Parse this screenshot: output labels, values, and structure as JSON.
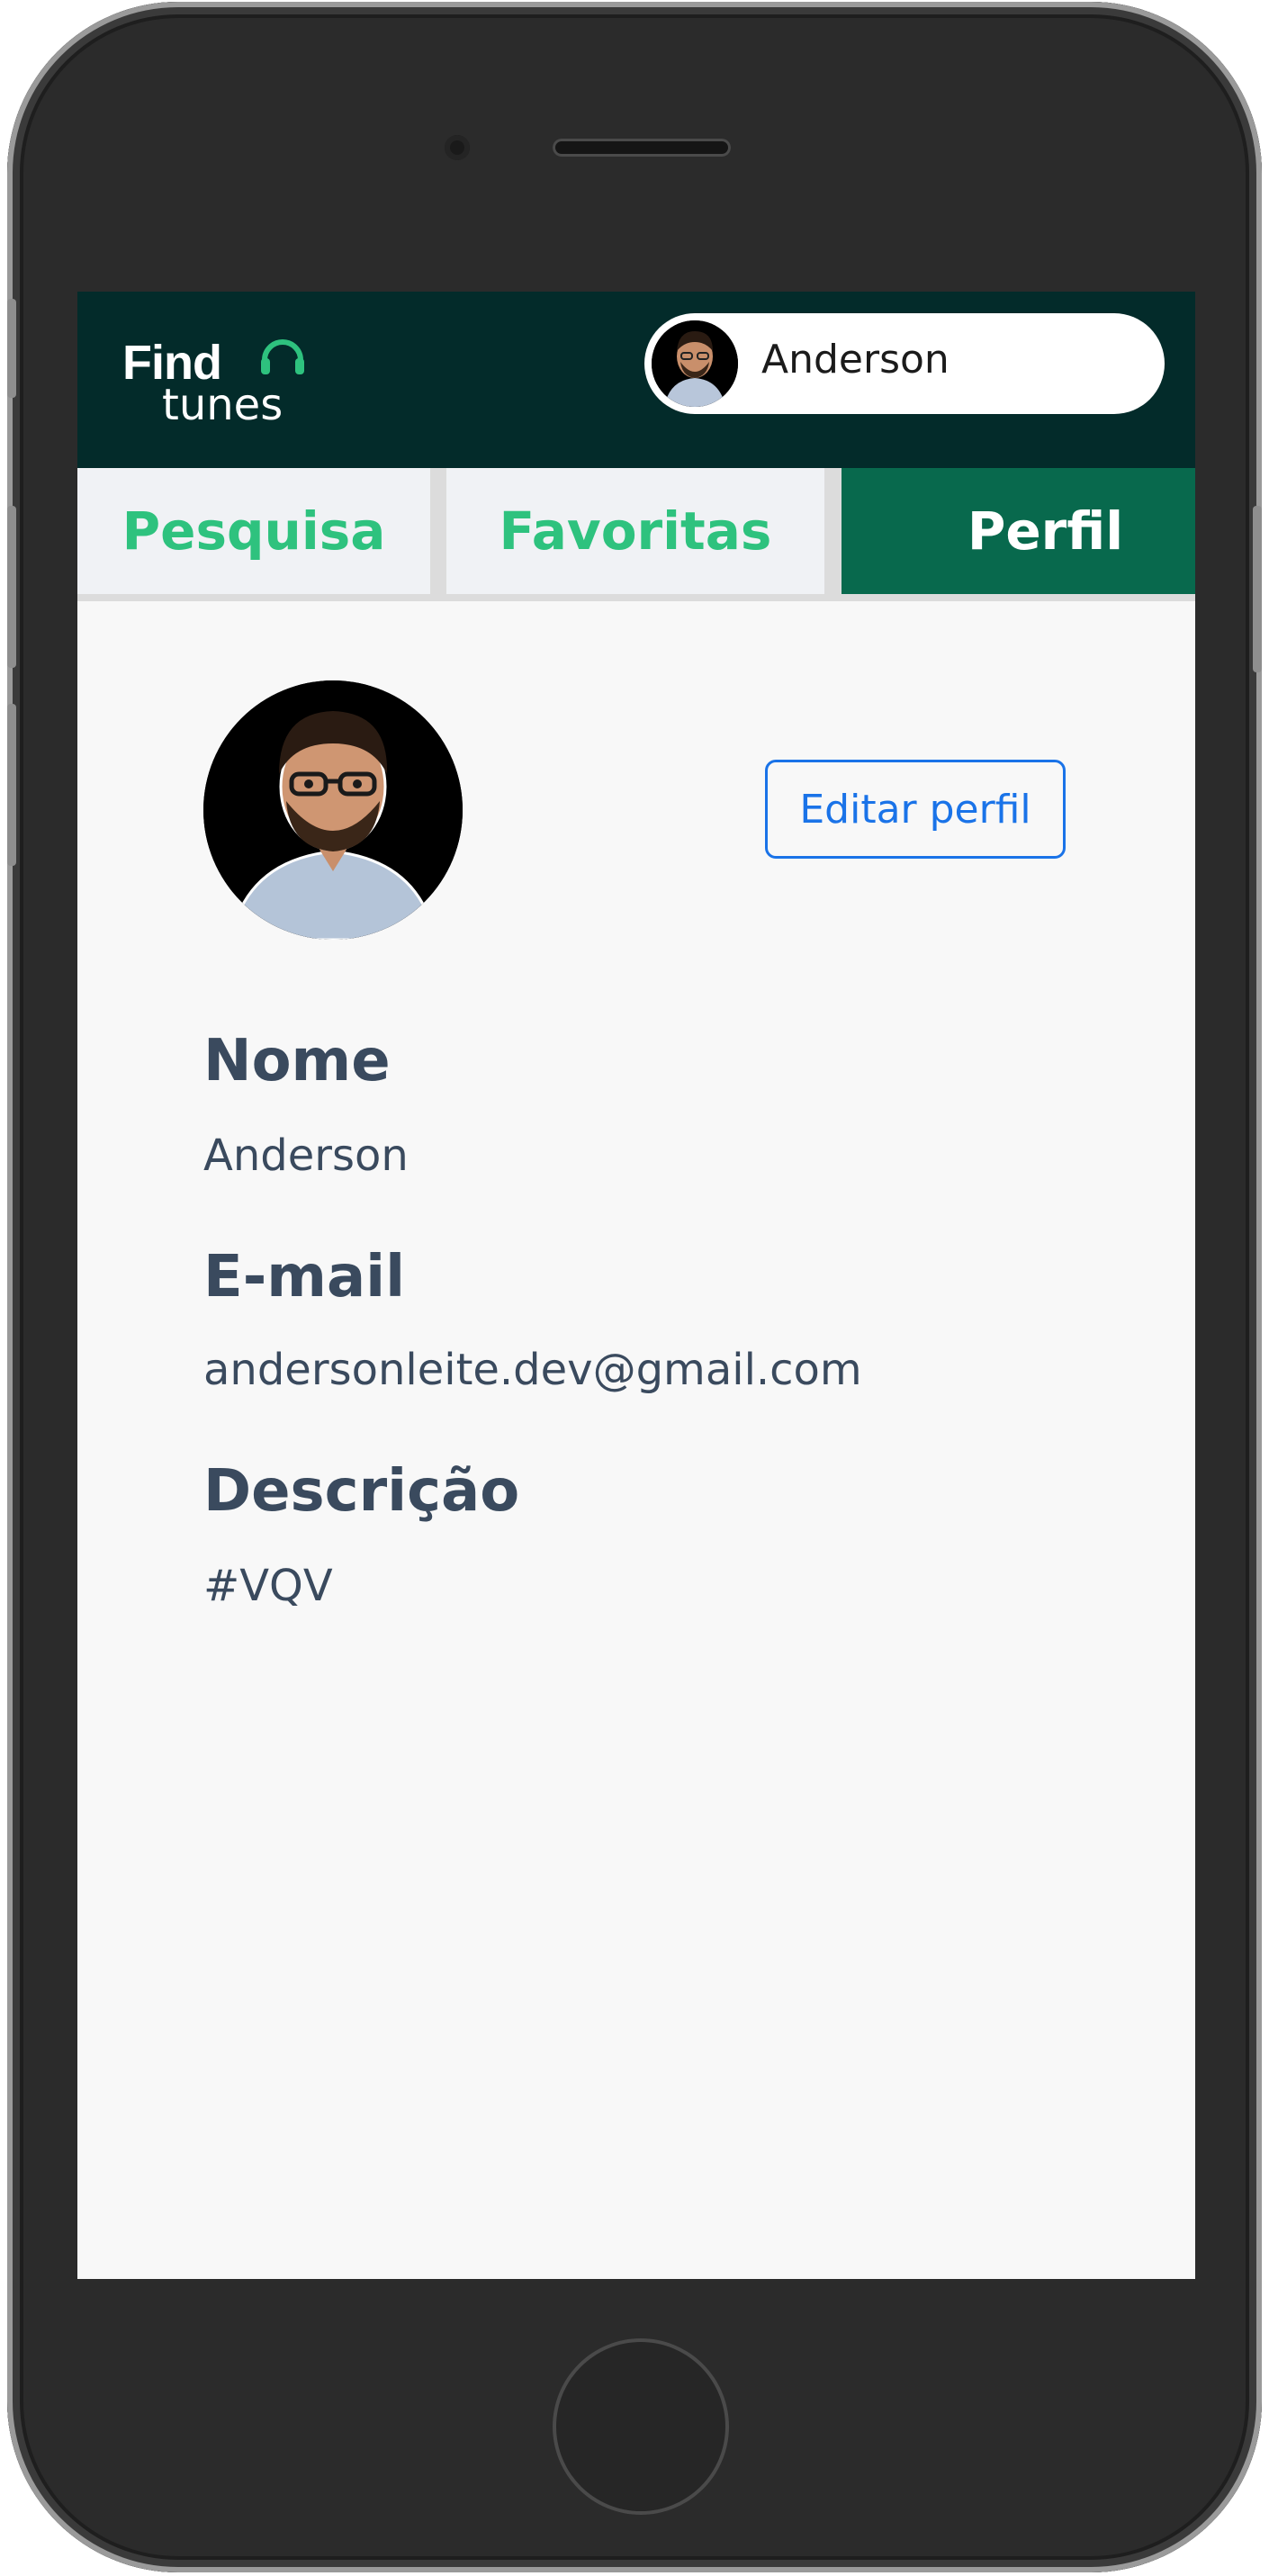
{
  "app": {
    "logo_line1": "Find",
    "logo_line2": "tunes",
    "brand_color": "#2ec27e",
    "header_color": "#032b2a"
  },
  "header": {
    "user_name": "Anderson",
    "avatar_icon": "user-avatar"
  },
  "tabs": [
    {
      "label": "Pesquisa",
      "active": false
    },
    {
      "label": "Favoritas",
      "active": false
    },
    {
      "label": "Perfil",
      "active": true
    }
  ],
  "profile": {
    "edit_button": "Editar perfil",
    "fields": [
      {
        "label": "Nome",
        "value": "Anderson"
      },
      {
        "label": "E-mail",
        "value": "andersonleite.dev@gmail.com"
      },
      {
        "label": "Descrição",
        "value": "#VQV"
      }
    ]
  }
}
